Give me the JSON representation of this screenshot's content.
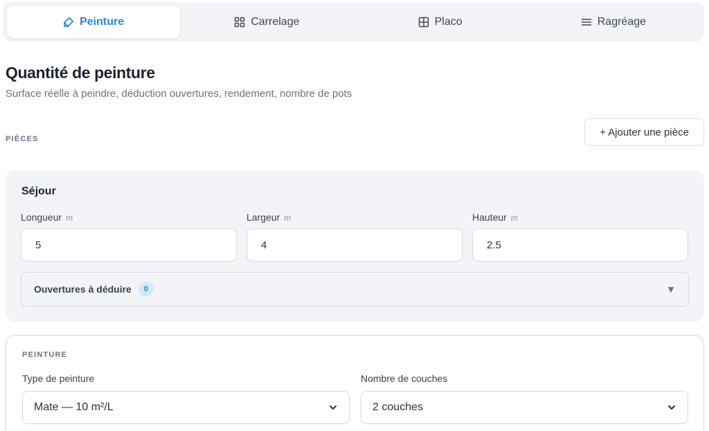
{
  "tabs": [
    {
      "label": "Peinture",
      "icon": "paint-tag-icon",
      "active": true
    },
    {
      "label": "Carrelage",
      "icon": "grid-icon",
      "active": false
    },
    {
      "label": "Placo",
      "icon": "panel-icon",
      "active": false
    },
    {
      "label": "Ragréage",
      "icon": "lines-icon",
      "active": false
    }
  ],
  "header": {
    "title": "Quantité de peinture",
    "subtitle": "Surface réelle à peindre, déduction ouvertures, rendement, nombre de pots"
  },
  "pieces": {
    "label": "PIÈCES",
    "add_button": "+ Ajouter une pièce"
  },
  "room": {
    "name": "Séjour",
    "fields": [
      {
        "label": "Longueur",
        "unit": "m",
        "value": "5"
      },
      {
        "label": "Largeur",
        "unit": "m",
        "value": "4"
      },
      {
        "label": "Hauteur",
        "unit": "m",
        "value": "2.5"
      }
    ],
    "openings": {
      "label": "Ouvertures à déduire",
      "count": "0",
      "caret": "▼"
    }
  },
  "paint": {
    "label": "PEINTURE",
    "type": {
      "label": "Type de peinture",
      "value": "Mate — 10 m²/L"
    },
    "coats": {
      "label": "Nombre de couches",
      "value": "2 couches"
    }
  },
  "colors": {
    "accent": "#2a86d6",
    "tab_bg": "#f3f4f7",
    "text": "#1c2230",
    "muted": "#6b7180",
    "border": "#d6d9df"
  }
}
